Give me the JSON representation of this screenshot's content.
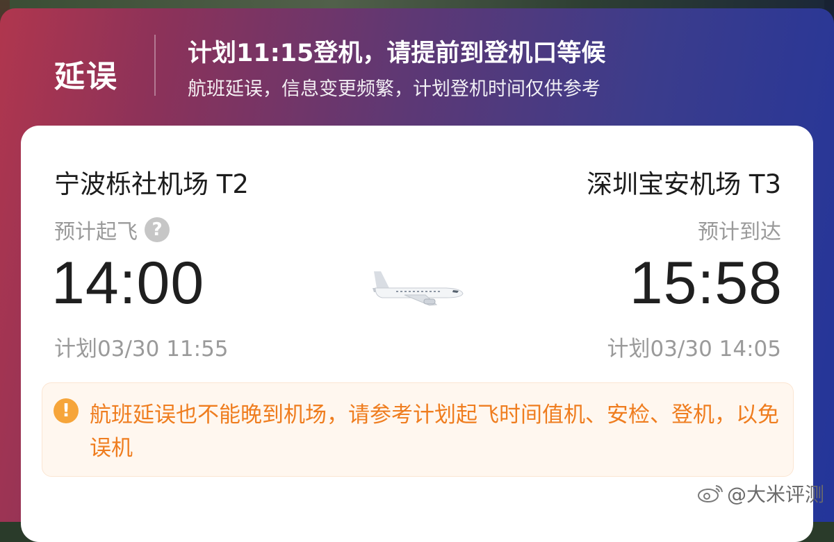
{
  "banner": {
    "status": "延误",
    "headline": "计划11:15登机，请提前到登机口等候",
    "subline": "航班延误，信息变更频繁，计划登机时间仅供参考"
  },
  "departure": {
    "airport": "宁波栎社机场 T2",
    "label": "预计起飞",
    "time": "14:00",
    "scheduled": "计划03/30 11:55"
  },
  "arrival": {
    "airport": "深圳宝安机场 T3",
    "label": "预计到达",
    "time": "15:58",
    "scheduled": "计划03/30 14:05"
  },
  "notice": {
    "icon": "!",
    "text": "航班延误也不能晚到机场，请参考计划起飞时间值机、安检、登机，以免误机"
  },
  "help_icon": "?",
  "watermark": "@大米评测",
  "colors": {
    "notice_text": "#ef7d1f",
    "notice_bg": "#fff7ef",
    "warn_icon": "#f6a53a"
  }
}
